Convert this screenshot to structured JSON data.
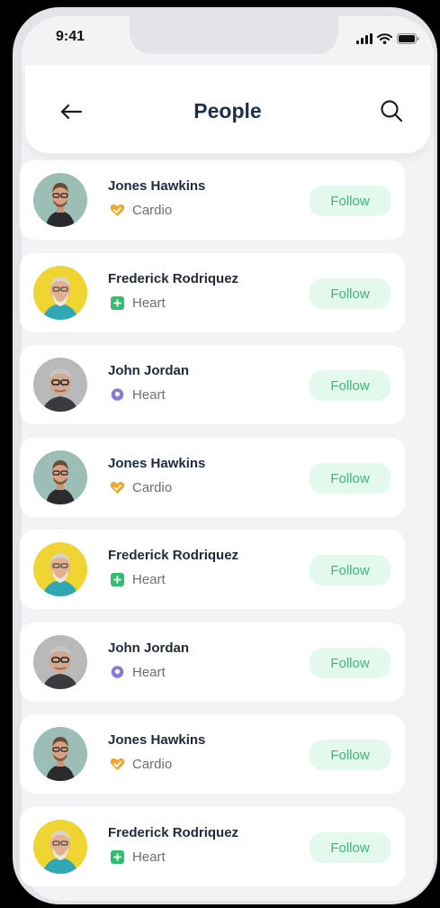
{
  "status_bar": {
    "time": "9:41"
  },
  "header": {
    "title": "People"
  },
  "colors": {
    "follow_bg": "#e4f9ee",
    "follow_text": "#3eb874",
    "title": "#1f2f48"
  },
  "people": [
    {
      "name": "Jones Hawkins",
      "tag": "Cardio",
      "tag_icon": "heart-check-icon",
      "follow_label": "Follow"
    },
    {
      "name": "Frederick Rodriquez",
      "tag": "Heart",
      "tag_icon": "green-plus-square-icon",
      "follow_label": "Follow"
    },
    {
      "name": "John Jordan",
      "tag": "Heart",
      "tag_icon": "purple-circle-icon",
      "follow_label": "Follow"
    },
    {
      "name": "Jones Hawkins",
      "tag": "Cardio",
      "tag_icon": "heart-check-icon",
      "follow_label": "Follow"
    },
    {
      "name": "Frederick Rodriquez",
      "tag": "Heart",
      "tag_icon": "green-plus-square-icon",
      "follow_label": "Follow"
    },
    {
      "name": "John Jordan",
      "tag": "Heart",
      "tag_icon": "purple-circle-icon",
      "follow_label": "Follow"
    },
    {
      "name": "Jones Hawkins",
      "tag": "Cardio",
      "tag_icon": "heart-check-icon",
      "follow_label": "Follow"
    },
    {
      "name": "Frederick Rodriquez",
      "tag": "Heart",
      "tag_icon": "green-plus-square-icon",
      "follow_label": "Follow"
    }
  ]
}
